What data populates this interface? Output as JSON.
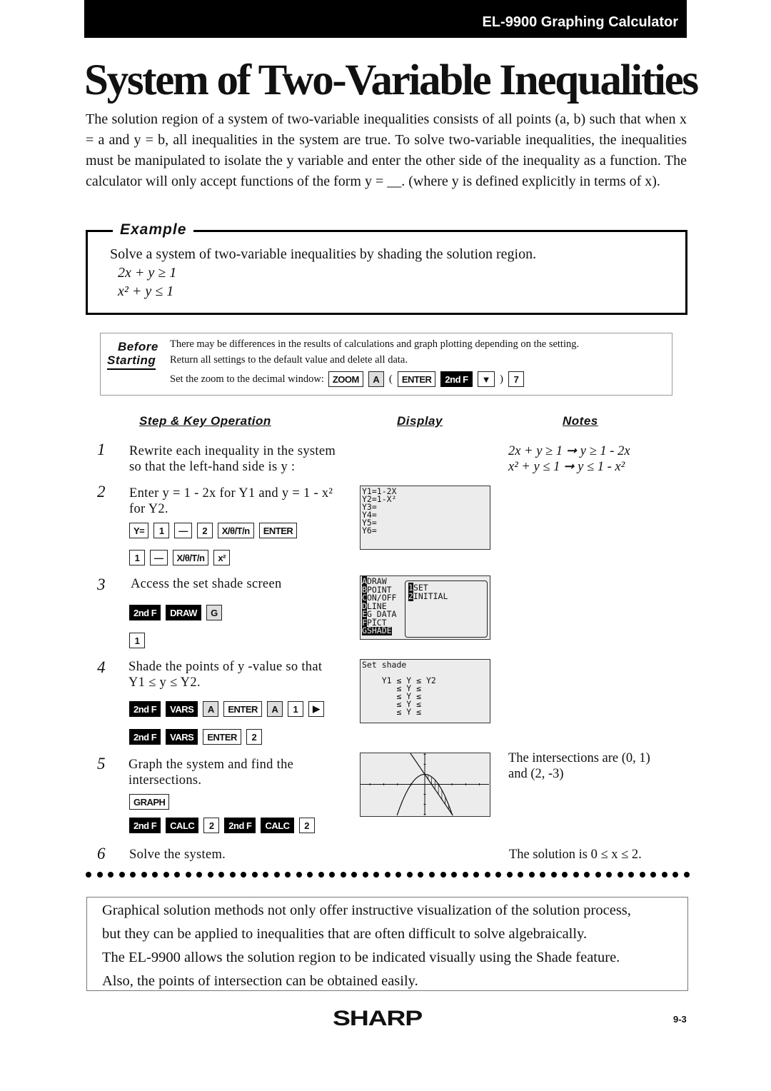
{
  "header": {
    "product": "EL-9900 Graphing Calculator"
  },
  "title": "System of Two-Variable Inequalities",
  "intro": "The solution region of a system of two-variable inequalities consists of all points (a, b) such that when x = a and y = b, all inequalities in the system are true. To solve two-variable inequalities, the inequalities must be manipulated to isolate the y variable and enter the other side of the inequality as a function. The calculator will only accept functions of the form y = __. (where y is defined explicitly in terms of x).",
  "example": {
    "label": "Example",
    "text": "Solve a system of two-variable inequalities by shading the solution region.",
    "ineq1": "2x + y ≥ 1",
    "ineq2": "x² + y ≤ 1"
  },
  "before_starting": {
    "label1": "Before",
    "label2": "Starting",
    "line1": "There may be differences in the results of calculations and graph plotting depending on the setting.",
    "line2": "Return all settings to the default value and delete all data.",
    "line3": "Set the zoom to the decimal window:",
    "keys": [
      [
        "ZOOM",
        "w"
      ],
      [
        "A",
        "g"
      ],
      [
        "(",
        "p"
      ],
      [
        "ENTER",
        "w"
      ],
      [
        "2nd F",
        "b"
      ],
      [
        "▼",
        "w"
      ],
      [
        ")",
        "p"
      ],
      [
        "7",
        "w"
      ]
    ]
  },
  "columns": {
    "step": "Step & Key Operation",
    "display": "Display",
    "notes": "Notes"
  },
  "steps": [
    {
      "n": "1",
      "text": [
        "Rewrite each inequality in the system",
        "so that the left-hand side is y :"
      ],
      "notes": [
        "2x + y ≥ 1 ➞ y ≥ 1 - 2x",
        "x² + y ≤ 1 ➞ y ≤ 1 - x²"
      ]
    },
    {
      "n": "2",
      "text": [
        "Enter y = 1 - 2x for Y1 and y = 1 - x²",
        "for Y2."
      ],
      "keys": [
        [
          [
            "Y=",
            "w"
          ],
          [
            "1",
            "w"
          ],
          [
            "—",
            "w"
          ],
          [
            "2",
            "w"
          ],
          [
            "X/θ/T/n",
            "w"
          ],
          [
            "ENTER",
            "w"
          ]
        ],
        [
          [
            "1",
            "w"
          ],
          [
            "—",
            "w"
          ],
          [
            "X/θ/T/n",
            "w"
          ],
          [
            "x²",
            "w"
          ]
        ]
      ],
      "screen": "Y1=1-2X\nY2=1-X²\nY3=\nY4=\nY5=\nY6="
    },
    {
      "n": "3",
      "text": [
        "Access the set shade screen"
      ],
      "keys": [
        [
          [
            "2nd F",
            "b"
          ],
          [
            "DRAW",
            "b"
          ],
          [
            "G",
            "g"
          ]
        ],
        [
          [
            "1",
            "w"
          ]
        ]
      ],
      "screen": {
        "menu": [
          "ADRAW",
          "BPOINT",
          "CON/OFF",
          "DLINE",
          "EG_DATA",
          "FPICT",
          "GSHADE"
        ],
        "sub": [
          "1SET",
          "2INITIAL"
        ]
      }
    },
    {
      "n": "4",
      "text": [
        "Shade the points of y -value so that",
        "Y1 ≤ y ≤ Y2."
      ],
      "keys": [
        [
          [
            "2nd F",
            "b"
          ],
          [
            "VARS",
            "b"
          ],
          [
            "A",
            "g"
          ],
          [
            "ENTER",
            "w"
          ],
          [
            "A",
            "g"
          ],
          [
            "1",
            "w"
          ],
          [
            "▶",
            "w"
          ]
        ],
        [
          [
            "2nd F",
            "b"
          ],
          [
            "VARS",
            "b"
          ],
          [
            "ENTER",
            "w"
          ],
          [
            "2",
            "w"
          ]
        ]
      ],
      "screen": "Set shade\n\n    Y1 ≤ Y ≤ Y2\n       ≤ Y ≤\n       ≤ Y ≤\n       ≤ Y ≤\n       ≤ Y ≤"
    },
    {
      "n": "5",
      "text": [
        "Graph the system and find the",
        "intersections."
      ],
      "keys": [
        [
          [
            "GRAPH",
            "w"
          ]
        ],
        [
          [
            "2nd F",
            "b"
          ],
          [
            "CALC",
            "b"
          ],
          [
            "2",
            "w"
          ],
          [
            "2nd F",
            "b"
          ],
          [
            "CALC",
            "b"
          ],
          [
            "2",
            "w"
          ]
        ]
      ],
      "notes": [
        "The intersections are (0, 1)",
        "and (2, -3)"
      ],
      "graph": {
        "y1": "1-2x",
        "y2": "1-x^2",
        "xlim": [
          -4.7,
          4.7
        ],
        "ylim": [
          -3.1,
          3.1
        ]
      }
    },
    {
      "n": "6",
      "text": [
        "Solve the system."
      ],
      "notes": [
        "The solution is 0 ≤ x ≤ 2."
      ]
    }
  ],
  "summary": [
    "Graphical solution methods not only offer instructive visualization of the solution process,",
    "but they can be applied to inequalities that are often difficult to solve algebraically.",
    "The EL-9900 allows the solution region to be indicated visually using the Shade feature.",
    "Also, the points of intersection can be obtained easily."
  ],
  "footer": {
    "logo": "SHARP",
    "page": "9-3"
  }
}
